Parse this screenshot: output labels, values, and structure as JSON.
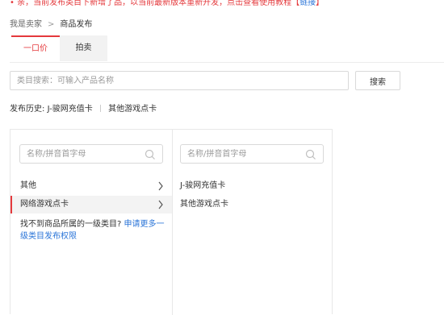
{
  "notice": {
    "text": "• 亲，当前发布类目下新增了品，以当前最新版本重新开发，点击查看使用教程【",
    "link": "链接",
    "tail": "】"
  },
  "breadcrumb": {
    "parent": "我是卖家",
    "current": "商品发布"
  },
  "tabs": [
    {
      "label": "一口价",
      "active": true
    },
    {
      "label": "拍卖",
      "active": false
    }
  ],
  "category_search": {
    "placeholder": "类目搜索：可输入产品名称",
    "button": "搜索"
  },
  "history": {
    "label": "发布历史:",
    "items": [
      "J-骏网充值卡",
      "其他游戏点卡"
    ]
  },
  "level1": {
    "search_placeholder": "名称/拼音首字母",
    "items": [
      {
        "label": "其他",
        "selected": false
      },
      {
        "label": "网络游戏点卡",
        "selected": true
      }
    ],
    "help_text": "找不到商品所属的一级类目?",
    "help_link": "申请更多一级类目发布权限"
  },
  "level2": {
    "search_placeholder": "名称/拼音首字母",
    "items": [
      "J-骏网充值卡",
      "其他游戏点卡"
    ]
  },
  "colors": {
    "accent": "#e4393c",
    "link": "#2b75d8"
  }
}
